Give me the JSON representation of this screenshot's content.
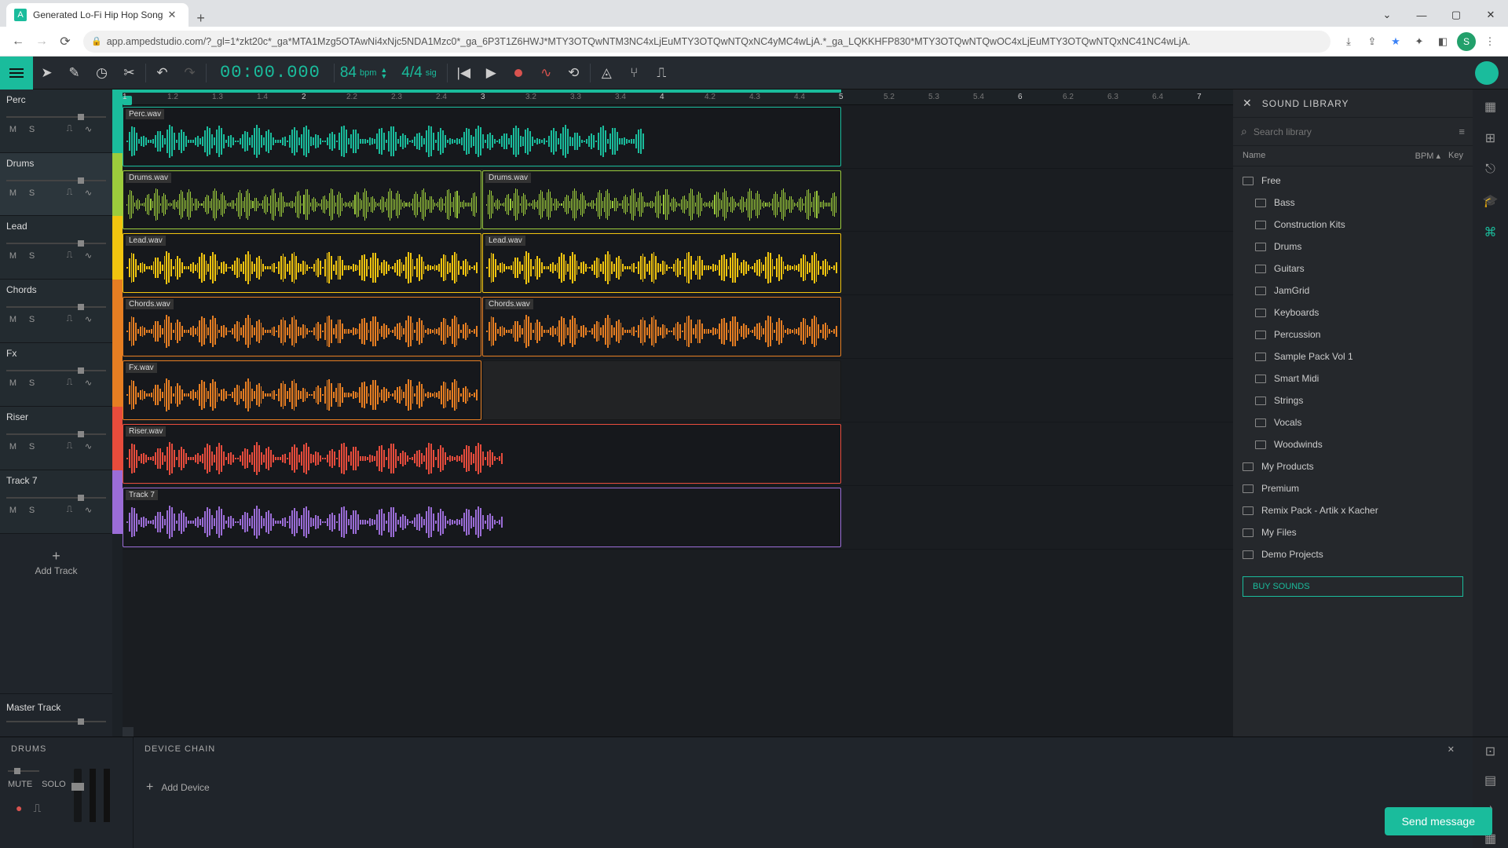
{
  "browser": {
    "tab_title": "Generated Lo-Fi Hip Hop Song",
    "url": "app.ampedstudio.com/?_gl=1*zkt20c*_ga*MTA1Mzg5OTAwNi4xNjc5NDA1Mzc0*_ga_6P3T1Z6HWJ*MTY3OTQwNTM3NC4xLjEuMTY3OTQwNTQxNC4yMC4wLjA.*_ga_LQKKHFP830*MTY3OTQwNTQwOC4xLjEuMTY3OTQwNTQxNC41NC4wLjA.",
    "profile_letter": "S"
  },
  "transport": {
    "time": "00:00.000",
    "bpm": "84",
    "bpm_label": "bpm",
    "sig": "4/4",
    "sig_label": "sig"
  },
  "tracks": [
    {
      "name": "Perc",
      "color": "#1abc9c",
      "clip": "Perc.wav",
      "selected": false
    },
    {
      "name": "Drums",
      "color": "#9ccc3c",
      "clip": "Drums.wav",
      "clip2": "Drums.wav",
      "selected": true
    },
    {
      "name": "Lead",
      "color": "#f1c40f",
      "clip": "Lead.wav",
      "clip2": "Lead.wav",
      "selected": false
    },
    {
      "name": "Chords",
      "color": "#e67e22",
      "clip": "Chords.wav",
      "clip2": "Chords.wav",
      "selected": false
    },
    {
      "name": "Fx",
      "color": "#e67e22",
      "clip": "Fx.wav",
      "selected": false
    },
    {
      "name": "Riser",
      "color": "#e74c3c",
      "clip": "Riser.wav",
      "selected": false
    },
    {
      "name": "Track 7",
      "color": "#9b6dd7",
      "clip": "Track 7",
      "selected": false
    }
  ],
  "add_track_label": "Add Track",
  "master_track_label": "Master Track",
  "track_buttons": {
    "m": "M",
    "s": "S"
  },
  "library": {
    "title": "SOUND LIBRARY",
    "search_placeholder": "Search library",
    "col_name": "Name",
    "col_bpm": "BPM ▴",
    "col_key": "Key",
    "tree": [
      {
        "label": "Free",
        "indent": 0
      },
      {
        "label": "Bass",
        "indent": 1
      },
      {
        "label": "Construction Kits",
        "indent": 1
      },
      {
        "label": "Drums",
        "indent": 1
      },
      {
        "label": "Guitars",
        "indent": 1
      },
      {
        "label": "JamGrid",
        "indent": 1
      },
      {
        "label": "Keyboards",
        "indent": 1
      },
      {
        "label": "Percussion",
        "indent": 1
      },
      {
        "label": "Sample Pack Vol 1",
        "indent": 1
      },
      {
        "label": "Smart Midi",
        "indent": 1
      },
      {
        "label": "Strings",
        "indent": 1
      },
      {
        "label": "Vocals",
        "indent": 1
      },
      {
        "label": "Woodwinds",
        "indent": 1
      },
      {
        "label": "My Products",
        "indent": 0
      },
      {
        "label": "Premium",
        "indent": 0
      },
      {
        "label": "Remix Pack - Artik x Kacher",
        "indent": 0
      },
      {
        "label": "My Files",
        "indent": 0
      },
      {
        "label": "Demo Projects",
        "indent": 0
      }
    ],
    "buy_label": "BUY SOUNDS"
  },
  "bottom": {
    "track_label": "DRUMS",
    "chain_label": "DEVICE CHAIN",
    "mute": "MUTE",
    "solo": "SOLO",
    "add_device": "Add Device"
  },
  "send_message": "Send message",
  "ruler_marks": [
    "1",
    "1.2",
    "1.3",
    "1.4",
    "2",
    "2.2",
    "2.3",
    "2.4",
    "3",
    "3.2",
    "3.3",
    "3.4",
    "4",
    "4.2",
    "4.3",
    "4.4",
    "5",
    "5.2",
    "5.3",
    "5.4",
    "6",
    "6.2",
    "6.3",
    "6.4",
    "7"
  ]
}
